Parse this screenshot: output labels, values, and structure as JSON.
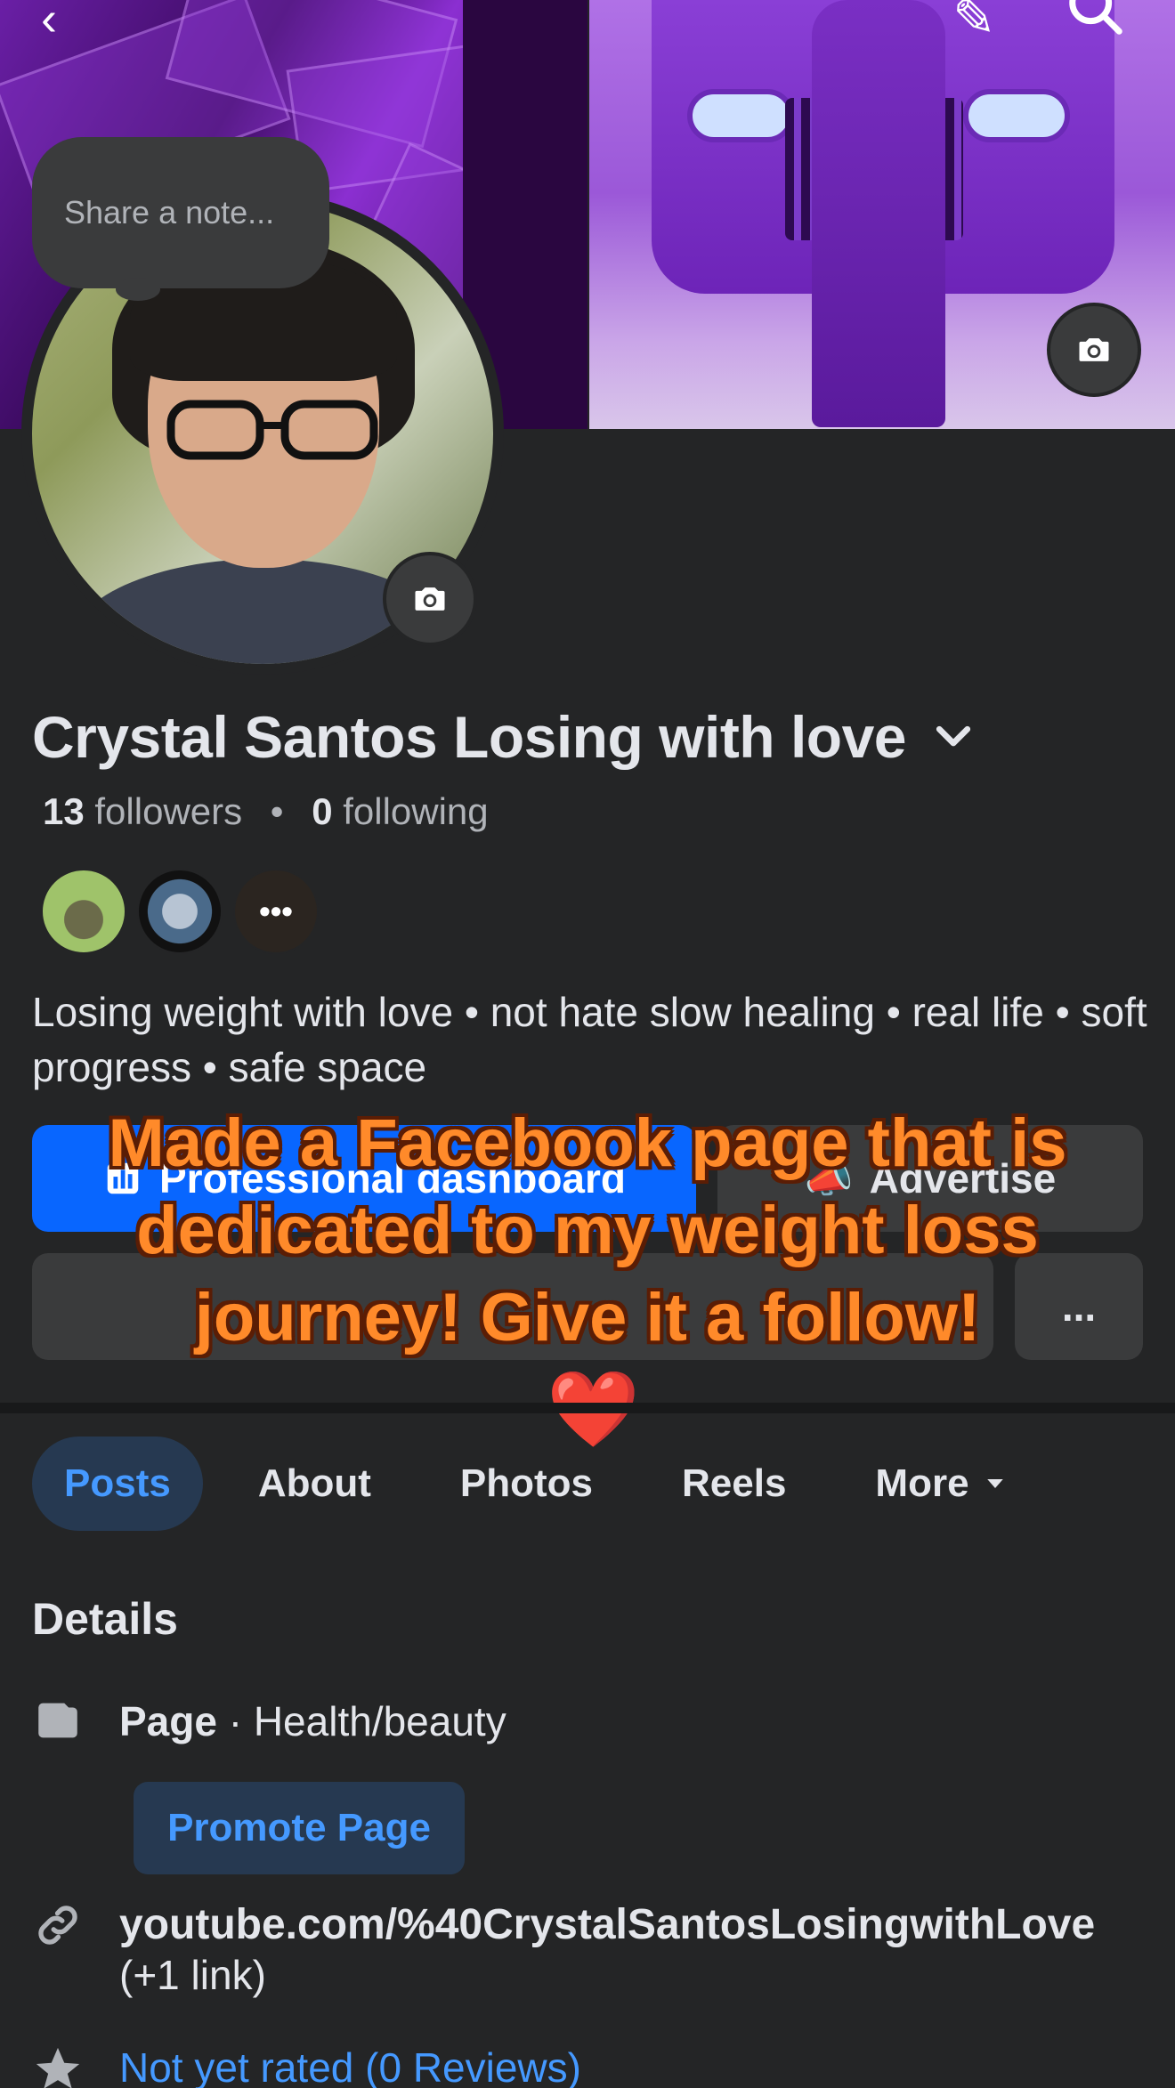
{
  "cover": {
    "nav": {
      "back_icon": "chevron-left-icon",
      "edit_icon": "pencil-icon",
      "search_icon": "search-icon"
    }
  },
  "note": {
    "placeholder": "Share a note..."
  },
  "profile": {
    "name": "Crystal Santos Losing with love",
    "followers_count": "13",
    "followers_label": "followers",
    "following_count": "0",
    "following_label": "following",
    "bio": "Losing weight with love • not hate slow healing • real life • soft progress • safe space"
  },
  "buttons": {
    "professional_dashboard": "Professional dashboard",
    "advertise": "Advertise",
    "more_dots": "..."
  },
  "overlay": {
    "caption": "Made a Facebook page that is dedicated to my weight loss journey! Give it a follow!",
    "emoji": "❤️"
  },
  "tabs": [
    {
      "label": "Posts",
      "active": true
    },
    {
      "label": "About"
    },
    {
      "label": "Photos"
    },
    {
      "label": "Reels"
    },
    {
      "label": "More"
    }
  ],
  "details": {
    "title": "Details",
    "page_label": "Page",
    "category": "· Health/beauty",
    "promote_label": "Promote Page",
    "link": "youtube.com/%40CrystalSantosLosingwithLove",
    "link_extra": "(+1 link)",
    "rating": "Not yet rated (0 Reviews)"
  },
  "colors": {
    "background": "#242526",
    "accent_blue": "#0866ff",
    "link_blue": "#4599ff",
    "overlay_orange": "#ff8a2a"
  }
}
